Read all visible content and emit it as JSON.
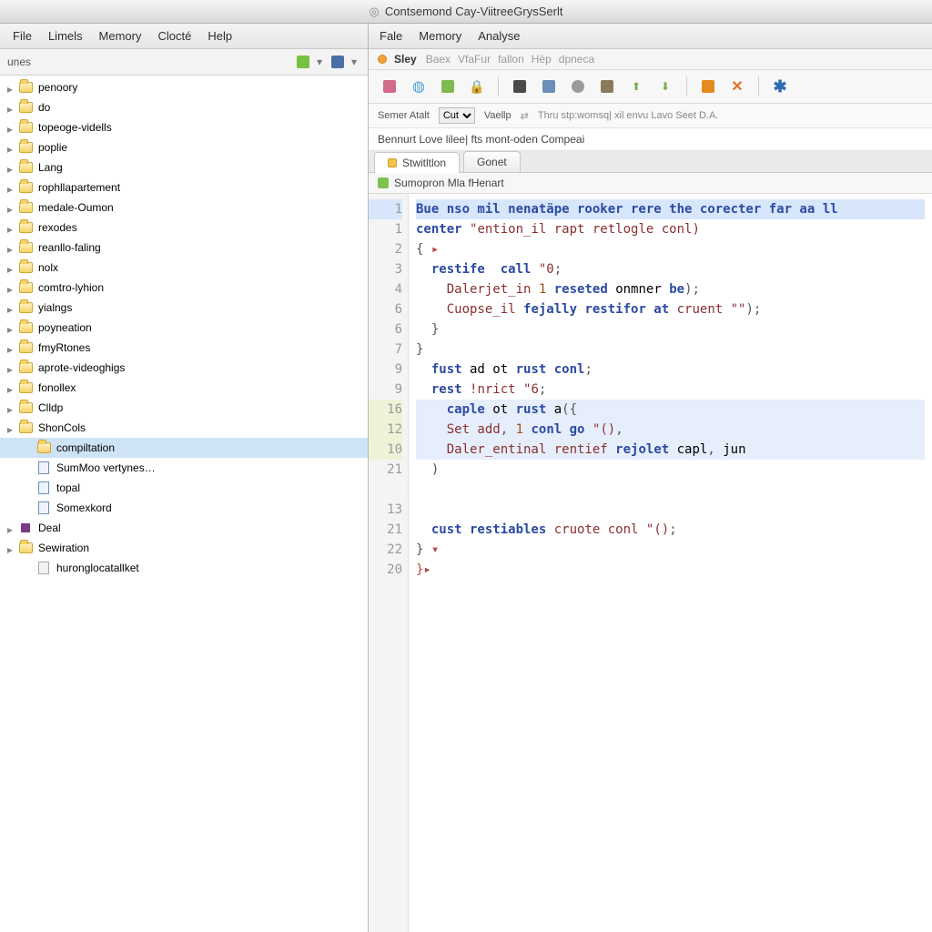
{
  "window": {
    "title": "Contsemond Cay-ViitreeGrysSerlt"
  },
  "left": {
    "menus": [
      "File",
      "Limels",
      "Memory",
      "Clocté",
      "Help"
    ],
    "panel_label": "unes",
    "tree": [
      {
        "label": "penoory",
        "icon": "folder",
        "depth": 1,
        "expandable": true
      },
      {
        "label": "do",
        "icon": "folder",
        "depth": 1,
        "expandable": true
      },
      {
        "label": "topeoge-vidells",
        "icon": "folder",
        "depth": 1,
        "expandable": true
      },
      {
        "label": "poplie",
        "icon": "folder",
        "depth": 1,
        "expandable": true
      },
      {
        "label": "Lang",
        "icon": "folder",
        "depth": 1,
        "expandable": true
      },
      {
        "label": "rophllapartement",
        "icon": "folder",
        "depth": 1,
        "expandable": true
      },
      {
        "label": "medale-Oumon",
        "icon": "folder",
        "depth": 1,
        "expandable": true
      },
      {
        "label": "rexodes",
        "icon": "folder",
        "depth": 1,
        "expandable": true
      },
      {
        "label": "reanllo-faling",
        "icon": "folder",
        "depth": 1,
        "expandable": true
      },
      {
        "label": "nolx",
        "icon": "folder",
        "depth": 1,
        "expandable": true
      },
      {
        "label": "comtro-lyhion",
        "icon": "folder",
        "depth": 1,
        "expandable": true
      },
      {
        "label": "yialngs",
        "icon": "folder",
        "depth": 1,
        "expandable": true
      },
      {
        "label": "poyneation",
        "icon": "folder",
        "depth": 1,
        "expandable": true
      },
      {
        "label": "fmyRtones",
        "icon": "folder",
        "depth": 1,
        "expandable": true
      },
      {
        "label": "aprote-videoghigs",
        "icon": "folder",
        "depth": 1,
        "expandable": true
      },
      {
        "label": "fonollex",
        "icon": "folder",
        "depth": 1,
        "expandable": true
      },
      {
        "label": "Clldp",
        "icon": "folder",
        "depth": 1,
        "expandable": true
      },
      {
        "label": "ShonCols",
        "icon": "folder",
        "depth": 1,
        "expandable": true
      },
      {
        "label": "compiltation",
        "icon": "folder",
        "depth": 2,
        "selected": true
      },
      {
        "label": "SumMoo vertynes…",
        "icon": "file-blue",
        "depth": 2
      },
      {
        "label": "topal",
        "icon": "file-blue",
        "depth": 2
      },
      {
        "label": "Somexkord",
        "icon": "file-blue",
        "depth": 2
      },
      {
        "label": "Deal",
        "icon": "square-purple",
        "depth": 1,
        "expandable": true
      },
      {
        "label": "Sewiration",
        "icon": "folder",
        "depth": 1,
        "expandable": true
      },
      {
        "label": "huronglocatallket",
        "icon": "file-gray",
        "depth": 2
      }
    ]
  },
  "right": {
    "menus": [
      "Fale",
      "Memory",
      "Analyse"
    ],
    "breadcrumb": {
      "strong": "Sley",
      "trail": [
        "Baex",
        "VfaFur",
        "fallon",
        "Hëp",
        "dpneca"
      ]
    },
    "toolbar_icons": [
      "building",
      "globe",
      "disk",
      "lock",
      "sep",
      "square-dark",
      "pencil",
      "circle",
      "card",
      "up-arrow",
      "down-arrow",
      "sep",
      "square-orange",
      "close-x",
      "sep",
      "star-blue"
    ],
    "config": {
      "label1": "Semer Atalt",
      "select_value": "Cut",
      "label2": "Vaellp",
      "note": "Thru stp:womsq| xil envu Lavo Seet D.A."
    },
    "descriptor": "Bennurt Love lilee| fts mont-oden Compeai",
    "tabs": [
      {
        "label": "Stwitltlon",
        "active": true
      },
      {
        "label": "Gonet",
        "active": false
      }
    ],
    "file_strip": "Sumopron Mla fHenart",
    "code": {
      "gutter": [
        "1",
        "1",
        "2",
        "3",
        "4",
        "6",
        "6",
        "7",
        "9",
        "9",
        "16",
        "12",
        "10",
        "21",
        "",
        "13",
        "21",
        "22",
        "20"
      ],
      "highlight_rows": [
        0,
        10,
        11,
        12
      ],
      "lines_html": [
        "<span class='tok-kw'>Bue nso mil nenatäpe rooker rere the corecter far aa ll</span>",
        "<span class='tok-kw'>center</span> <span class='tok-str'>\"ention_il rapt retlogle conl)</span>",
        "<span class='tok-punc'>{ </span><span class='tok-fold'>▸</span>",
        "  <span class='tok-kw'>restife  call</span> <span class='tok-str'>\"0</span><span class='tok-punc'>;</span>",
        "    <span class='tok-name'>Dalerjet_in</span> <span class='tok-num'>1</span> <span class='tok-kw'>reseted</span> onmner <span class='tok-kw'>be</span><span class='tok-punc'>);</span>",
        "    <span class='tok-name'>Cuopse_il</span> <span class='tok-kw'>fejally restifor at</span> <span class='tok-name'>cruent</span> <span class='tok-str'>\"\"</span><span class='tok-punc'>);</span>",
        "  <span class='tok-punc'>}</span>",
        "<span class='tok-punc'>}</span>",
        "  <span class='tok-kw'>fust</span> ad ot <span class='tok-kw'>rust conl</span><span class='tok-punc'>;</span>",
        "  <span class='tok-kw'>rest</span> <span class='tok-name'>!nrict</span> <span class='tok-str'>\"6</span><span class='tok-punc'>;</span>",
        "    <span class='tok-kw'>caple</span> ot <span class='tok-kw'>rust</span> a<span class='tok-punc'>({</span>",
        "    <span class='tok-name'>Set add</span><span class='tok-punc'>,</span> <span class='tok-num'>1</span> <span class='tok-kw'>conl go</span> <span class='tok-str'>\"()</span><span class='tok-punc'>,</span>",
        "    <span class='tok-name'>Daler_entinal rentief</span> <span class='tok-kw'>rejolet</span> capl<span class='tok-punc'>,</span> jun",
        "  <span class='tok-punc'>)</span>",
        " ",
        " ",
        "  <span class='tok-kw'>cust restiables</span> <span class='tok-name'>cruote conl</span> <span class='tok-str'>\"()</span><span class='tok-punc'>;</span>",
        "<span class='tok-punc'>}</span> <span class='tok-fold'>▾</span>",
        "<span class='tok-punc' style='color:#b94444'>}▸</span>"
      ]
    }
  },
  "colors": {
    "selection": "#cfe3f7",
    "highlight": "#e6eefb",
    "accent_orange": "#e58a1f",
    "accent_blue": "#2c6ab2"
  }
}
